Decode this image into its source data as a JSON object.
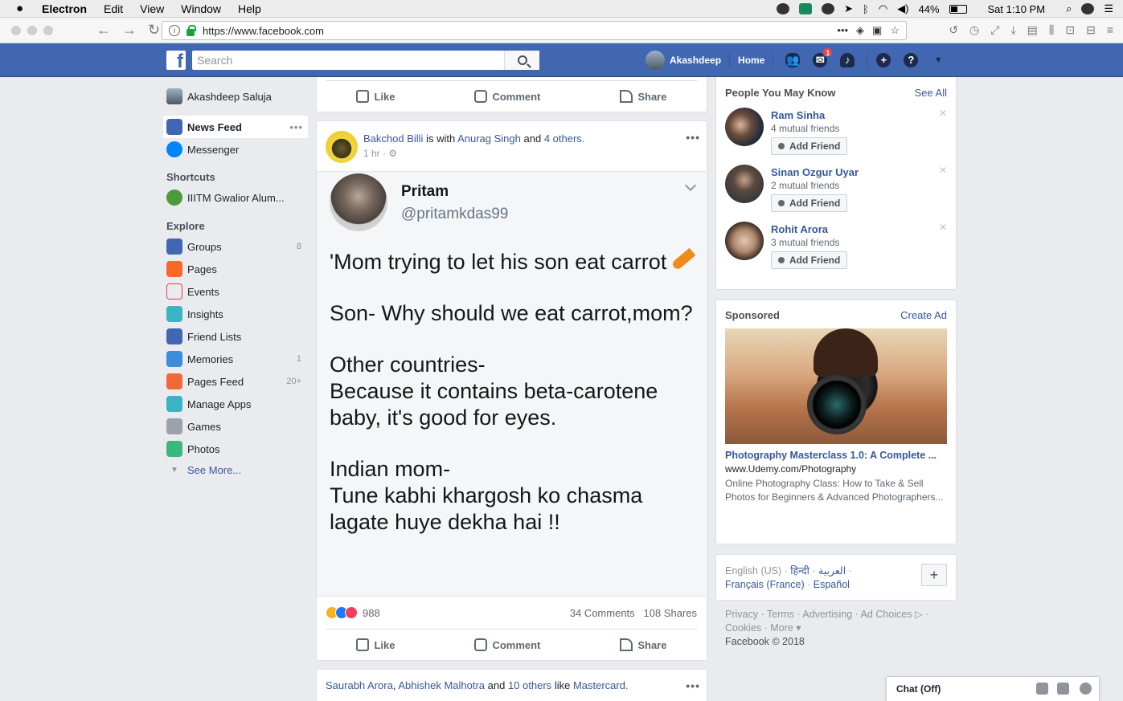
{
  "menubar": {
    "app": "Electron",
    "items": [
      "Edit",
      "View",
      "Window",
      "Help"
    ],
    "battery": "44%",
    "clock": "Sat 1:10 PM"
  },
  "browser": {
    "url": "https://www.facebook.com"
  },
  "fb": {
    "search_placeholder": "Search",
    "user_name": "Akashdeep",
    "home": "Home",
    "messages_badge": "1"
  },
  "left": {
    "profile": "Akashdeep Saluja",
    "news_feed": "News Feed",
    "messenger": "Messenger",
    "shortcuts_title": "Shortcuts",
    "shortcut_1": "IIITM Gwalior Alum...",
    "explore_title": "Explore",
    "explore": [
      {
        "label": "Groups",
        "count": "8",
        "color": "#4267b2"
      },
      {
        "label": "Pages",
        "count": "",
        "color": "#f5692b"
      },
      {
        "label": "Events",
        "count": "",
        "color": "#e9ebee"
      },
      {
        "label": "Insights",
        "count": "",
        "color": "#3bb3c3"
      },
      {
        "label": "Friend Lists",
        "count": "",
        "color": "#4267b2"
      },
      {
        "label": "Memories",
        "count": "1",
        "color": "#3b8ed7"
      },
      {
        "label": "Pages Feed",
        "count": "20+",
        "color": "#f06a35"
      },
      {
        "label": "Manage Apps",
        "count": "",
        "color": "#3bb3c3"
      },
      {
        "label": "Games",
        "count": "",
        "color": "#9aa3ad"
      },
      {
        "label": "Photos",
        "count": "",
        "color": "#3bb77e"
      }
    ],
    "see_more": "See More..."
  },
  "feed": {
    "like": "Like",
    "comment": "Comment",
    "share": "Share",
    "post": {
      "author": "Bakchod Billi",
      "with_text": "is with",
      "tagged": "Anurag Singh",
      "and_text": "and",
      "others": "4 others.",
      "time": "1 hr ·",
      "tweet_name": "Pritam",
      "tweet_handle": "@pritamkdas99",
      "tweet_p1": "'Mom trying to let his son eat carrot",
      "tweet_p2": "Son- Why should we eat carrot,mom?",
      "tweet_p3a": "Other countries-",
      "tweet_p3b": "Because it contains beta-carotene baby, it's good for eyes.",
      "tweet_p4a": "Indian mom-",
      "tweet_p4b": "Tune kabhi khargosh ko chasma lagate huye dekha hai !!",
      "reactions": "988",
      "comments": "34 Comments",
      "shares": "108 Shares"
    },
    "next_post": {
      "name1": "Saurabh Arora",
      "name2": "Abhishek Malhotra",
      "and_text": "and",
      "others": "10 others",
      "like_text": "like",
      "page": "Mastercard."
    }
  },
  "right": {
    "pymk_title": "People You May Know",
    "see_all": "See All",
    "people": [
      {
        "name": "Ram Sinha",
        "mutual": "4 mutual friends"
      },
      {
        "name": "Sinan Ozgur Uyar",
        "mutual": "2 mutual friends"
      },
      {
        "name": "Rohit Arora",
        "mutual": "3 mutual friends"
      }
    ],
    "add_friend": "Add Friend",
    "sponsored": "Sponsored",
    "create_ad": "Create Ad",
    "ad_title": "Photography Masterclass 1.0: A Complete ...",
    "ad_url": "www.Udemy.com/Photography",
    "ad_desc": "Online Photography Class: How to Take & Sell Photos for Beginners & Advanced Photographers...",
    "lang_current": "English (US) ·",
    "lang_hi": "हिन्दी",
    "lang_ar": "العربية",
    "lang_fr": "Français (France)",
    "lang_es": "Español",
    "footer_1": "Privacy · Terms · Advertising · Ad Choices ▷ ·",
    "footer_2": "Cookies · More ▾",
    "copyright": "Facebook © 2018"
  },
  "chat": {
    "label": "Chat (Off)"
  }
}
